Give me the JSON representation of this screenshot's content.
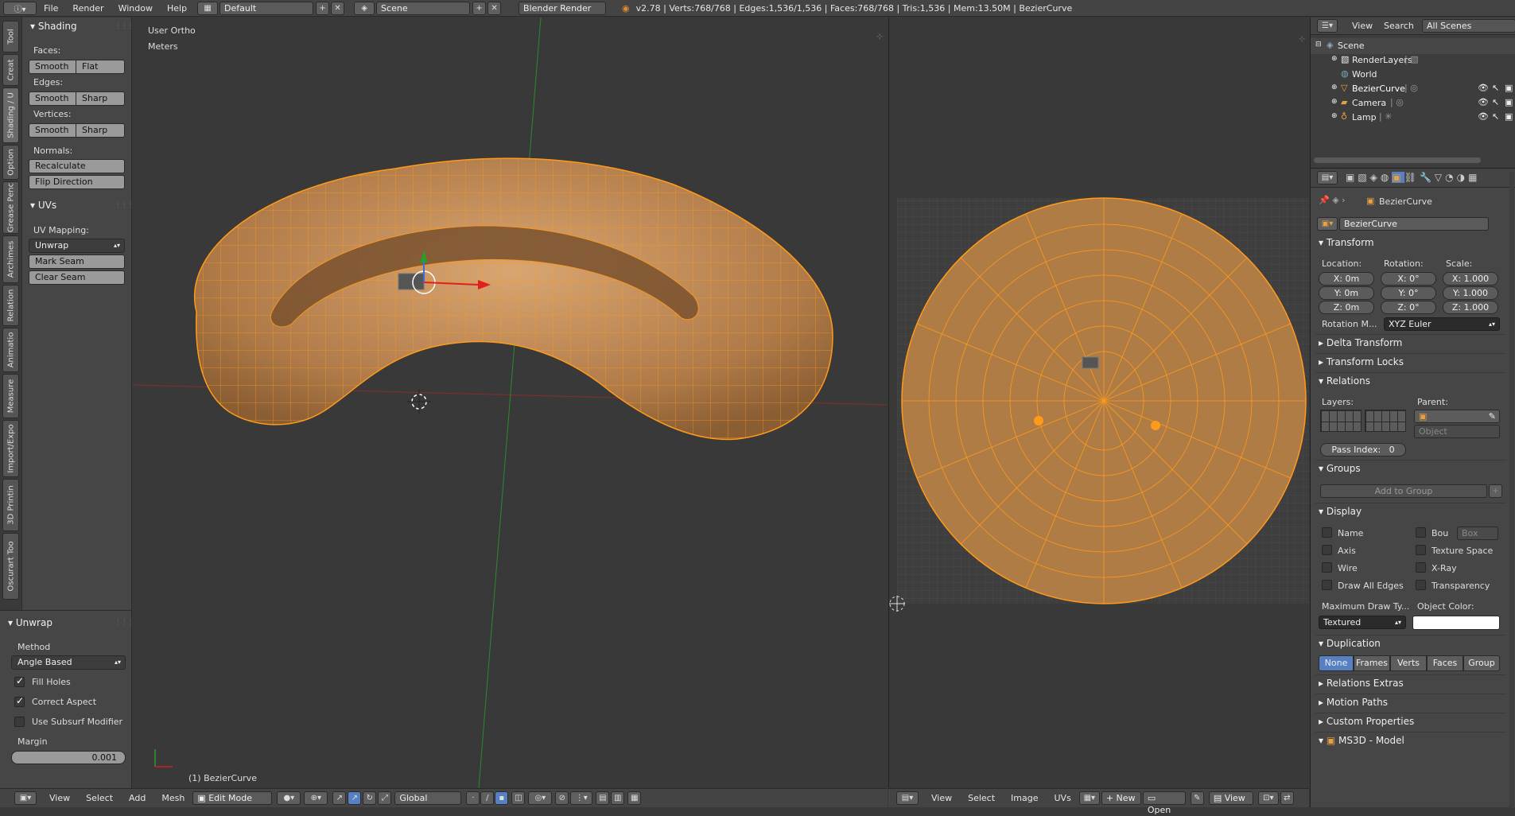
{
  "topbar": {
    "menus": [
      "File",
      "Render",
      "Window",
      "Help"
    ],
    "layout": "Default",
    "scene": "Scene",
    "engine": "Blender Render",
    "stats": "v2.78 | Verts:768/768 | Edges:1,536/1,536 | Faces:768/768 | Tris:1,536 | Mem:13.50M | BezierCurve"
  },
  "tabs": [
    "Tool",
    "Creat",
    "Shading / U",
    "Option",
    "Grease Penc",
    "Archimes",
    "Relation",
    "Animatio",
    "Measure",
    "Import/Expo",
    "3D Printin",
    "Oscurart Too"
  ],
  "shading": {
    "title": "Shading",
    "faces_label": "Faces:",
    "smooth": "Smooth",
    "flat": "Flat",
    "edges_label": "Edges:",
    "sharp": "Sharp",
    "vertices_label": "Vertices:",
    "normals_label": "Normals:",
    "recalculate": "Recalculate",
    "flip": "Flip Direction"
  },
  "uvs": {
    "title": "UVs",
    "mapping_label": "UV Mapping:",
    "unwrap": "Unwrap",
    "mark_seam": "Mark Seam",
    "clear_seam": "Clear Seam"
  },
  "redo": {
    "title": "Unwrap",
    "method_label": "Method",
    "method": "Angle Based",
    "fill_holes": "Fill Holes",
    "correct_aspect": "Correct Aspect",
    "use_subsurf": "Use Subsurf Modifier",
    "margin_label": "Margin",
    "margin": "0.001"
  },
  "viewport": {
    "view_name": "User Ortho",
    "units": "Meters",
    "object_label": "(1) BezierCurve"
  },
  "bottom3d": {
    "menus": [
      "View",
      "Select",
      "Add",
      "Mesh"
    ],
    "mode": "Edit Mode",
    "orientation": "Global"
  },
  "bottomuv": {
    "menus": [
      "View",
      "Select",
      "Image",
      "UVs"
    ],
    "new": "New",
    "open": "Open",
    "view": "View"
  },
  "outliner": {
    "view": "View",
    "search": "Search",
    "filter": "All Scenes",
    "items": [
      "Scene",
      "RenderLayers",
      "World",
      "BezierCurve",
      "Camera",
      "Lamp"
    ]
  },
  "props": {
    "breadcrumb": "BezierCurve",
    "object_name": "BezierCurve",
    "transform": "Transform",
    "location_label": "Location:",
    "rotation_label": "Rotation:",
    "scale_label": "Scale:",
    "loc": [
      "X:",
      "0m",
      "Y:",
      "0m",
      "Z:",
      "0m"
    ],
    "rot": [
      "X:",
      "0°",
      "Y:",
      "0°",
      "Z:",
      "0°"
    ],
    "scale": [
      "X:",
      "1.000",
      "Y:",
      "1.000",
      "Z:",
      "1.000"
    ],
    "rotation_mode_label": "Rotation M...",
    "rotation_mode": "XYZ Euler",
    "delta": "Delta Transform",
    "locks": "Transform Locks",
    "relations": "Relations",
    "layers_label": "Layers:",
    "parent_label": "Parent:",
    "parent_type": "Object",
    "pass_index_label": "Pass Index:",
    "pass_index": "0",
    "groups": "Groups",
    "add_group": "Add to Group",
    "display": "Display",
    "disp_left": [
      "Name",
      "Axis",
      "Wire",
      "Draw All Edges"
    ],
    "disp_right": [
      "Bou",
      "Texture Space",
      "X-Ray",
      "Transparency"
    ],
    "bounds_type": "Box",
    "max_draw_label": "Maximum Draw Ty...",
    "object_color_label": "Object Color:",
    "max_draw": "Textured",
    "duplication": "Duplication",
    "dup_tabs": [
      "None",
      "Frames",
      "Verts",
      "Faces",
      "Group"
    ],
    "relations_extras": "Relations Extras",
    "motion_paths": "Motion Paths",
    "custom_props": "Custom Properties",
    "ms3d": "MS3D - Model"
  },
  "colors": {
    "mesh_fill": "#c08a55",
    "wire": "#ff9a1a",
    "accent": "#5680c2"
  }
}
